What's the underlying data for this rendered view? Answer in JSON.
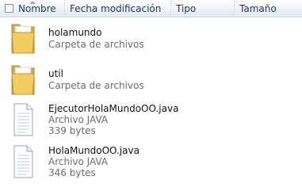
{
  "columns": {
    "nombre": "Nombre",
    "fecha": "Fecha modificación",
    "tipo": "Tipo",
    "tamano": "Tamaño"
  },
  "items": [
    {
      "name": "holamundo",
      "type": "Carpeta de archivos",
      "icon": "folder-icon"
    },
    {
      "name": "util",
      "type": "Carpeta de archivos",
      "icon": "folder-icon"
    },
    {
      "name": "EjecutorHolaMundoOO.java",
      "type": "Archivo JAVA",
      "size": "339 bytes",
      "icon": "document-icon"
    },
    {
      "name": "HolaMundoOO.java",
      "type": "Archivo JAVA",
      "size": "346 bytes",
      "icon": "document-icon"
    }
  ]
}
